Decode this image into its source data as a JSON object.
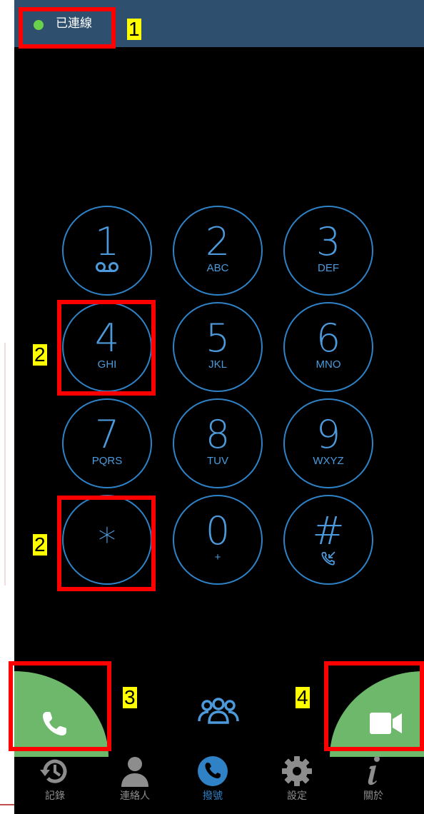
{
  "status": {
    "text": "已連線",
    "dot_color": "#69d24b",
    "bar_color": "#2e4f6d"
  },
  "dialpad": {
    "keys": [
      {
        "digit": "1",
        "sub": "",
        "sub_icon": "voicemail-icon"
      },
      {
        "digit": "2",
        "sub": "ABC"
      },
      {
        "digit": "3",
        "sub": "DEF"
      },
      {
        "digit": "4",
        "sub": "GHI"
      },
      {
        "digit": "5",
        "sub": "JKL"
      },
      {
        "digit": "6",
        "sub": "MNO"
      },
      {
        "digit": "7",
        "sub": "PQRS"
      },
      {
        "digit": "8",
        "sub": "TUV"
      },
      {
        "digit": "9",
        "sub": "WXYZ"
      },
      {
        "digit": "*",
        "sub": ""
      },
      {
        "digit": "0",
        "sub": "+"
      },
      {
        "digit": "#",
        "sub": "",
        "sub_icon": "call-transfer-icon"
      }
    ],
    "key_color": "#4c9adb"
  },
  "actions": {
    "call_icon": "phone-icon",
    "group_icon": "conference-icon",
    "video_icon": "video-camera-icon",
    "button_color": "#6db86b"
  },
  "nav": {
    "items": [
      {
        "label": "記錄",
        "icon": "history-icon"
      },
      {
        "label": "連絡人",
        "icon": "contact-icon"
      },
      {
        "label": "撥號",
        "icon": "phone-icon",
        "active": true
      },
      {
        "label": "設定",
        "icon": "gear-icon"
      },
      {
        "label": "關於",
        "icon": "info-icon"
      }
    ],
    "active_color": "#2f82c6",
    "inactive_color": "#8d8d8d"
  },
  "annotations": {
    "markers": [
      "1",
      "2",
      "2",
      "3",
      "4"
    ],
    "box_color": "#ff0000",
    "label_bg": "#ffff00"
  }
}
